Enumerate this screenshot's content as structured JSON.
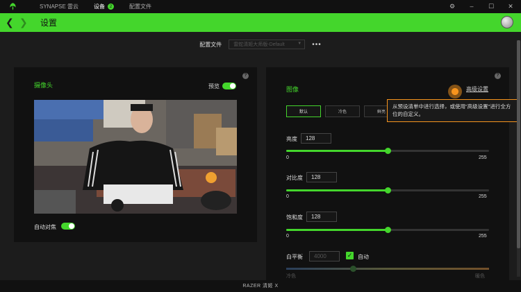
{
  "titlebar": {
    "tabs": [
      {
        "label": "SYNAPSE 雷云",
        "active": false
      },
      {
        "label": "设备",
        "active": true,
        "badge": "2"
      },
      {
        "label": "配置文件",
        "active": false
      }
    ]
  },
  "header": {
    "title": "设置"
  },
  "profile": {
    "label": "配置文件",
    "value": "雷蛇清姬大师版-Default",
    "more": "•••"
  },
  "camera_panel": {
    "title": "摄像头",
    "preview_label": "预览",
    "autofocus_label": "自动对焦"
  },
  "image_panel": {
    "title": "图像",
    "advanced_label": "高级设置",
    "tooltip": "从预设清单中进行选择，或使用\"高级设置\"进行全方位的自定义。",
    "presets": [
      "默认",
      "冷色",
      "鲜亮"
    ],
    "brightness": {
      "label": "亮度",
      "value": 128,
      "min": "0",
      "max": "255",
      "fraction": 0.5
    },
    "contrast": {
      "label": "对比度",
      "value": 128,
      "min": "0",
      "max": "255",
      "fraction": 0.5
    },
    "saturation": {
      "label": "饱和度",
      "value": 128,
      "min": "0",
      "max": "255",
      "fraction": 0.5
    },
    "white_balance": {
      "label": "白平衡",
      "value": "4000",
      "auto_label": "自动",
      "cold": "冷色",
      "warm": "暖色",
      "fraction": 0.33
    }
  },
  "footer": {
    "device": "RAZER 清姬 X"
  },
  "colors": {
    "accent": "#44d62c",
    "tooltip_border": "#f7941d"
  }
}
